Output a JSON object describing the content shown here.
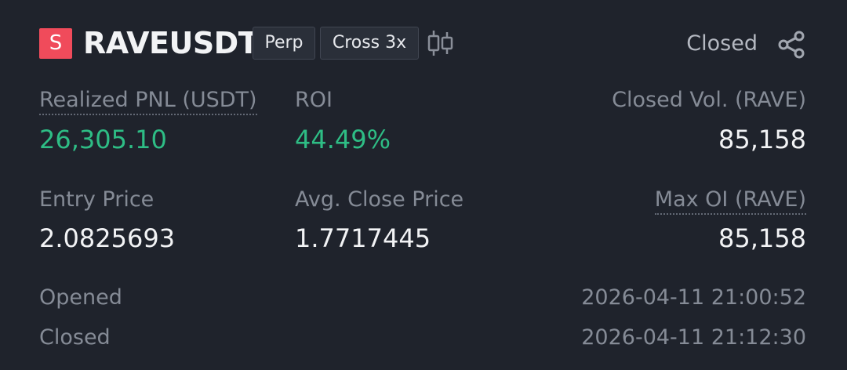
{
  "header": {
    "side_badge": "S",
    "symbol": "RAVEUSDT",
    "tags": [
      "Perp",
      "Cross 3x"
    ],
    "status": "Closed",
    "candle_icon": "candlestick-chart-icon",
    "share_icon": "share-icon"
  },
  "stats": {
    "realized_pnl": {
      "label": "Realized PNL (USDT)",
      "value": "26,305.10"
    },
    "roi": {
      "label": "ROI",
      "value": "44.49%"
    },
    "closed_vol": {
      "label": "Closed Vol. (RAVE)",
      "value": "85,158"
    },
    "entry_price": {
      "label": "Entry Price",
      "value": "2.0825693"
    },
    "avg_close_price": {
      "label": "Avg. Close Price",
      "value": "1.7717445"
    },
    "max_oi": {
      "label": "Max OI (RAVE)",
      "value": "85,158"
    }
  },
  "times": {
    "opened": {
      "label": "Opened",
      "value": "2026-04-11 21:00:52"
    },
    "closed": {
      "label": "Closed",
      "value": "2026-04-11 21:12:30"
    }
  },
  "colors": {
    "background": "#1f232c",
    "positive": "#2ebd85",
    "short_badge": "#f04b5b"
  }
}
